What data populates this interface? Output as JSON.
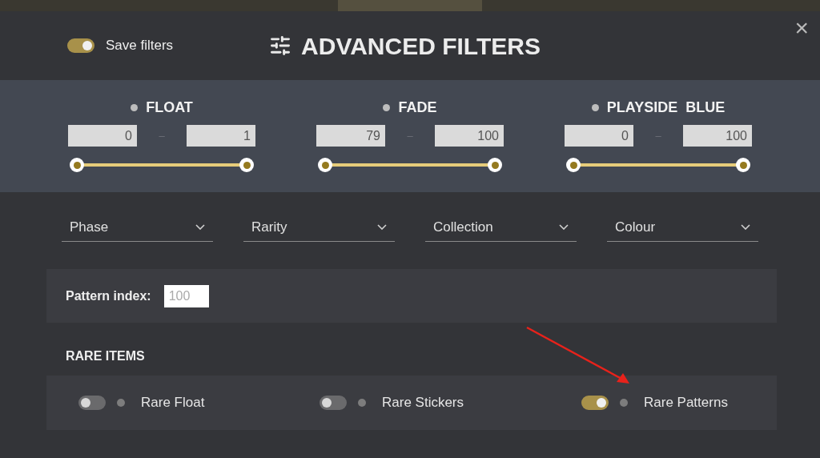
{
  "save_filters": {
    "label": "Save filters",
    "on": true
  },
  "title": "ADVANCED FILTERS",
  "close": "×",
  "ranges": [
    {
      "label": "FLOAT",
      "min": "0",
      "max": "1",
      "separator": "–"
    },
    {
      "label": "FADE",
      "min": "79",
      "max": "100",
      "separator": "–"
    },
    {
      "label": "PLAYSIDE  BLUE",
      "min": "0",
      "max": "100",
      "separator": "–"
    }
  ],
  "dropdowns": [
    "Phase",
    "Rarity",
    "Collection",
    "Colour"
  ],
  "pattern_index": {
    "label": "Pattern index:",
    "placeholder": "100"
  },
  "rare_items": {
    "heading": "RARE ITEMS",
    "items": [
      {
        "label": "Rare Float",
        "on": false
      },
      {
        "label": "Rare Stickers",
        "on": false
      },
      {
        "label": "Rare Patterns",
        "on": true
      }
    ]
  }
}
